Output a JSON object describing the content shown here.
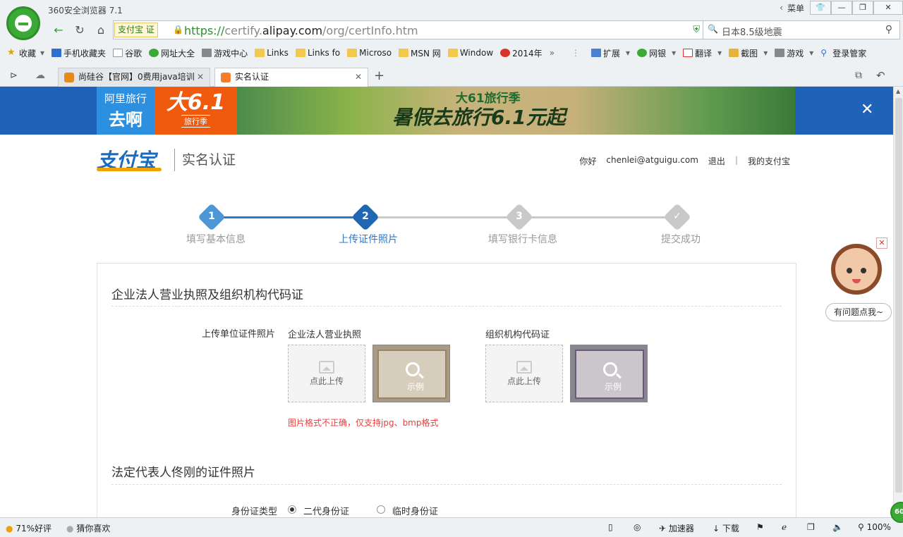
{
  "browser": {
    "app_title": "360安全浏览器 7.1",
    "menu_label": "菜单",
    "cert_tag": "支付宝 证",
    "url_scheme": "https://",
    "url_host_pre": "certify.",
    "url_host_main": "alipay.com",
    "url_path": "/org/certInfo.htm",
    "search_value": "日本8.5级地震",
    "bookmarks": [
      "收藏",
      "手机收藏夹",
      "谷歌",
      "网址大全",
      "游戏中心",
      "Links",
      "Links fo",
      "Microso",
      "MSN 网",
      "Window",
      "2014年"
    ],
    "toolbar_right": [
      "扩展",
      "网银",
      "翻译",
      "截图",
      "游戏",
      "登录管家"
    ],
    "tabs": [
      {
        "label": "尚硅谷【官网】0费用java培训"
      },
      {
        "label": "实名认证"
      }
    ]
  },
  "banner": {
    "brand_small": "阿里旅行",
    "brand_large": "去啊",
    "promo_big": "大6.1",
    "promo_small": "旅行季",
    "tagline_top": "大61旅行季",
    "tagline_main": "暑假去旅行6.1元起"
  },
  "header": {
    "logo_text": "支付宝",
    "page_title": "实名认证",
    "greeting": "你好",
    "email": "chenlei@atguigu.com",
    "logout": "退出",
    "separator": "|",
    "my_alipay": "我的支付宝"
  },
  "steps": [
    {
      "num": "1",
      "label": "填写基本信息"
    },
    {
      "num": "2",
      "label": "上传证件照片"
    },
    {
      "num": "3",
      "label": "填写银行卡信息"
    },
    {
      "num": "",
      "label": "提交成功"
    }
  ],
  "section1": {
    "title": "企业法人营业执照及组织机构代码证",
    "upload_label": "上传单位证件照片",
    "license_label": "企业法人营业执照",
    "org_label": "组织机构代码证",
    "upload_text": "点此上传",
    "sample_text": "示例",
    "error": "图片格式不正确，仅支持jpg、bmp格式"
  },
  "section2": {
    "title": "法定代表人佟刚的证件照片",
    "id_type_label": "身份证类型",
    "opt1": "二代身份证",
    "opt2": "临时身份证"
  },
  "helper": {
    "ask": "有问题点我~"
  },
  "statusbar": {
    "rating": "71%好评",
    "guess": "猜你喜欢",
    "accelerator": "加速器",
    "download": "下载",
    "zoom": "100%",
    "badge": "60"
  }
}
